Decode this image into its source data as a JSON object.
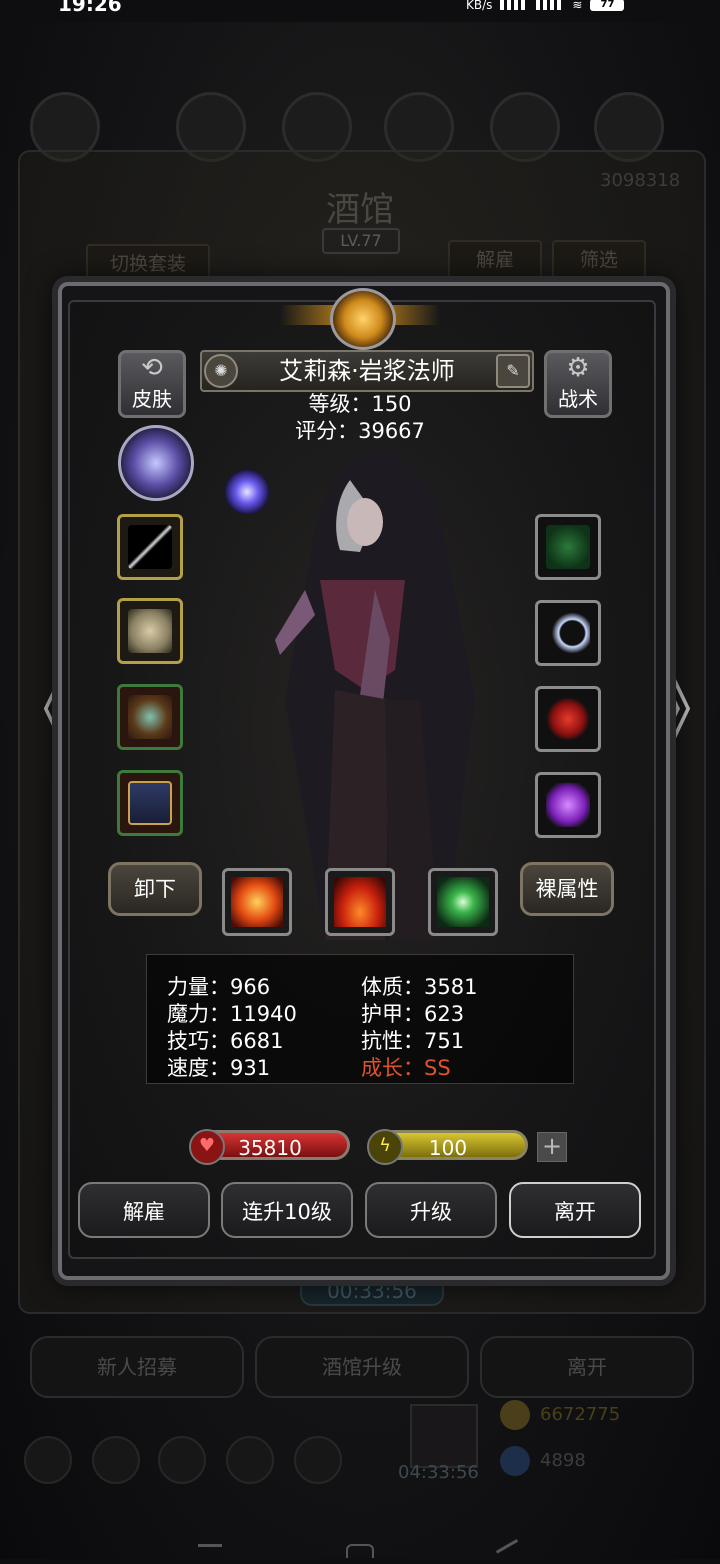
{
  "status": {
    "time": "19:26",
    "kbs": "KB/s",
    "battery": "77"
  },
  "background": {
    "title": "酒馆",
    "level": "LV.77",
    "switch_outfit": "切换套装",
    "dismiss": "解雇",
    "filter": "筛选",
    "gold_amount": "3098318",
    "timer": "00:33:56",
    "newbie_recruit": "新人招募",
    "tavern_upgrade": "酒馆升级",
    "leave": "离开",
    "gold": "6672775",
    "gift_timer": "04:33:56",
    "gems": "4898"
  },
  "hero": {
    "name": "艾莉森·岩浆法师",
    "level_label": "等级：150",
    "score_label": "评分：39667"
  },
  "buttons": {
    "skin": "皮肤",
    "tactics": "战术",
    "unequip": "卸下",
    "naked_attr": "裸属性"
  },
  "stats": {
    "strength": "力量：966",
    "constitution": "体质：3581",
    "magic": "魔力：11940",
    "armor": "护甲：623",
    "skill": "技巧：6681",
    "resistance": "抗性：751",
    "speed": "速度：931",
    "growth": "成长：SS"
  },
  "bars": {
    "hp": "35810",
    "energy": "100",
    "plus": "+"
  },
  "actions": {
    "dismiss": "解雇",
    "level10": "连升10级",
    "upgrade": "升级",
    "leave": "离开"
  },
  "nav": {
    "prev": "《",
    "next": "》"
  },
  "colors": {
    "growth": "#e0522c",
    "hp": "#d83434",
    "energy": "#d8c630"
  }
}
